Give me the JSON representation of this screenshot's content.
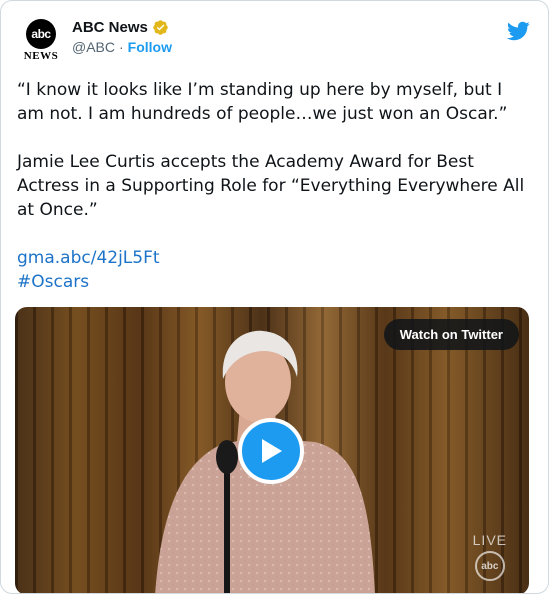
{
  "account": {
    "logo_text": "abc",
    "logo_subtext": "NEWS",
    "display_name": "ABC News",
    "handle": "@ABC",
    "separator": "·",
    "follow_label": "Follow"
  },
  "tweet": {
    "quote": "“I know it looks like I’m standing up here by myself, but I am not. I am hundreds of people…we just won an Oscar.”",
    "body": "Jamie Lee Curtis accepts the Academy Award for Best Actress in a Supporting Role for “Everything Everywhere All at Once.”",
    "link": "gma.abc/42jL5Ft",
    "hashtag": "#Oscars"
  },
  "media": {
    "watch_label": "Watch on Twitter",
    "live_label": "LIVE",
    "live_logo_text": "abc"
  },
  "icons": {
    "verified": "verified-badge-icon",
    "twitter": "twitter-bird-icon",
    "play": "play-icon"
  },
  "colors": {
    "brand_blue": "#1d9bf0",
    "verified_gold": "#e2b719",
    "link_blue": "#1d73c8",
    "text": "#0f1419",
    "muted": "#536471"
  }
}
